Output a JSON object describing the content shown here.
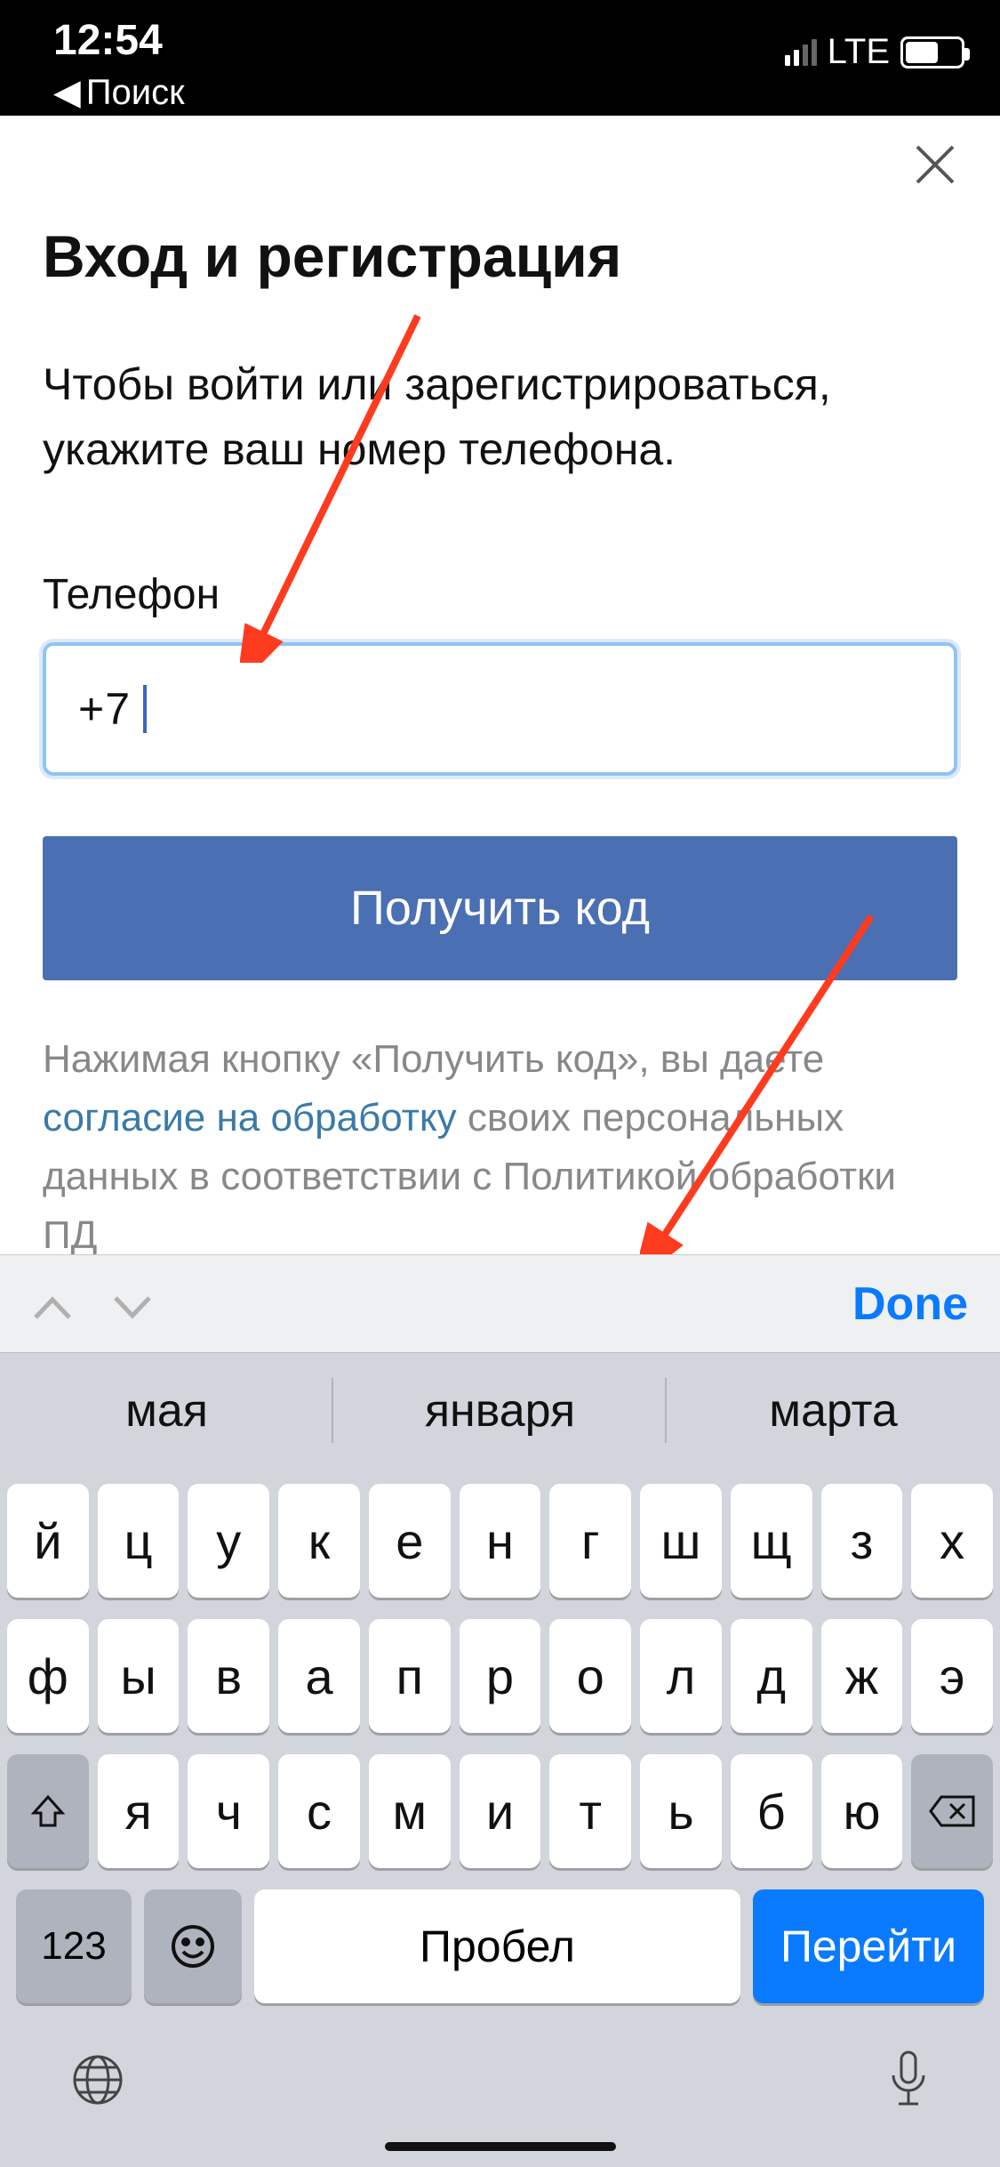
{
  "status": {
    "time": "12:54",
    "back_label": "Поиск",
    "network": "LTE"
  },
  "page": {
    "title": "Вход и регистрация",
    "instruction": "Чтобы войти или зарегистрироваться, укажите ваш номер телефона.",
    "field_label": "Телефон",
    "phone_value": "+7",
    "button": "Получить код",
    "disclaimer_pre": "Нажимая кнопку «Получить код», вы даете ",
    "disclaimer_link": "согласие на обработку",
    "disclaimer_post": " своих персональных данных в соответствии с Политикой обработки ПД"
  },
  "keyboard": {
    "done": "Done",
    "suggestions": [
      "мая",
      "января",
      "марта"
    ],
    "row1": [
      "й",
      "ц",
      "у",
      "к",
      "е",
      "н",
      "г",
      "ш",
      "щ",
      "з",
      "х"
    ],
    "row2": [
      "ф",
      "ы",
      "в",
      "а",
      "п",
      "р",
      "о",
      "л",
      "д",
      "ж",
      "э"
    ],
    "row3": [
      "я",
      "ч",
      "с",
      "м",
      "и",
      "т",
      "ь",
      "б",
      "ю"
    ],
    "key123": "123",
    "space": "Пробел",
    "go": "Перейти"
  }
}
